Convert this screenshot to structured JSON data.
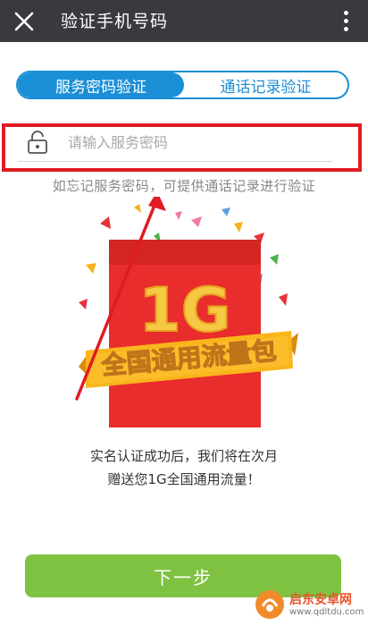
{
  "header": {
    "title": "验证手机号码"
  },
  "tabs": [
    {
      "label": "服务密码验证",
      "active": true
    },
    {
      "label": "通话记录验证",
      "active": false
    }
  ],
  "password_field": {
    "placeholder": "请输入服务密码",
    "value": ""
  },
  "hint": "如忘记服务密码，可提供通话记录进行验证",
  "promo": {
    "amount": "1G",
    "banner": "全国通用流量包"
  },
  "description": {
    "line1": "实名认证成功后，我们将在次月",
    "line2": "赠送您1G全国通用流量！"
  },
  "next_button": "下一步",
  "watermark": {
    "name": "启东安卓网",
    "url": "www.qdltdu.com"
  },
  "colors": {
    "titlebar": "#393a3f",
    "accent": "#1a8fd6",
    "button": "#7fc241",
    "highlight": "#e01b22"
  }
}
